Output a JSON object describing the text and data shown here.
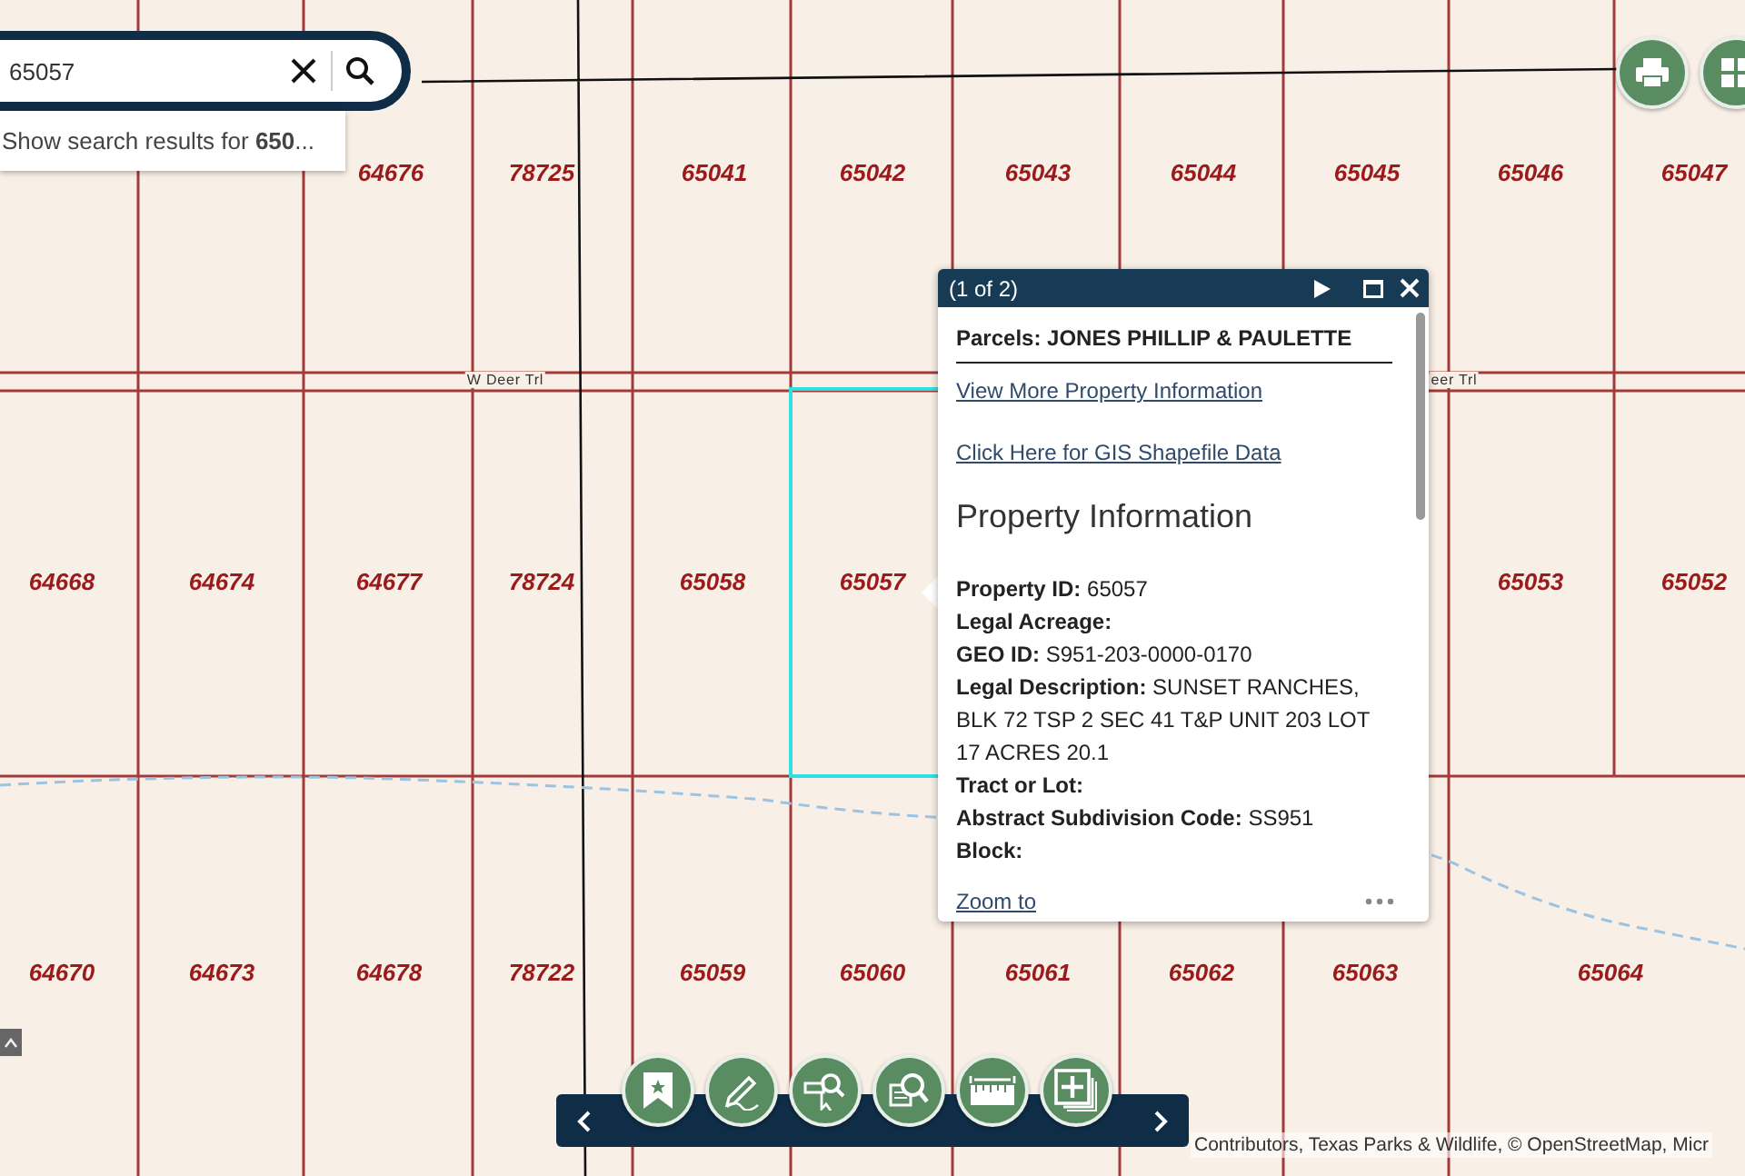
{
  "search": {
    "value": "65057",
    "suggestion": "Show search results for **650**..."
  },
  "map": {
    "parcel_labels": [
      "64676",
      "78725",
      "65041",
      "65042",
      "65043",
      "65044",
      "65045",
      "65046",
      "65047",
      "64668",
      "64674",
      "64677",
      "78724",
      "65058",
      "65057",
      "65053",
      "65052",
      "64670",
      "64673",
      "64678",
      "78722",
      "65059",
      "65060",
      "65061",
      "65062",
      "65063",
      "65064"
    ],
    "road_labels": [
      "W Deer Trl",
      "eer Trl"
    ],
    "attribution": "Contributors, Texas Parks & Wildlife, © OpenStreetMap, Micr"
  },
  "popup": {
    "counter": "(1 of 2)",
    "title": "Parcels: JONES PHILLIP & PAULETTE",
    "links": [
      "View More Property Information",
      "Click Here for GIS Shapefile Data"
    ],
    "heading": "Property Information",
    "fields": [
      {
        "label": "Property ID:",
        "value": "65057"
      },
      {
        "label": "Legal Acreage:"
      },
      {
        "label": "GEO ID:",
        "value": "S951-203-0000-0170"
      },
      {
        "label": "Legal Description:",
        "value": "SUNSET RANCHES, BLK 72 TSP 2 SEC 41 T&P UNIT 203 LOT 17 ACRES 20.1"
      },
      {
        "label": "Tract or Lot:"
      },
      {
        "label": "Abstract Subdivision Code:",
        "value": "SS951"
      },
      {
        "label": "Block:"
      }
    ],
    "zoom_link": "Zoom to"
  }
}
